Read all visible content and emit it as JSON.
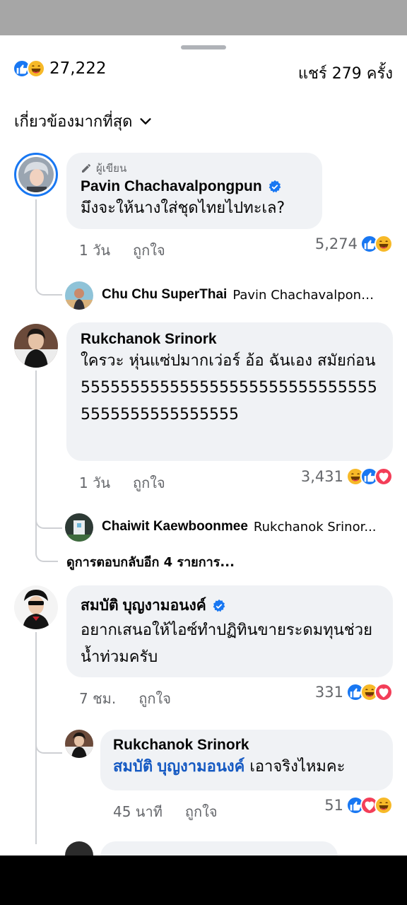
{
  "header": {
    "reaction_total": "27,222",
    "share_count": "แชร์ 279 ครั้ง",
    "reaction_icons": [
      "like-icon",
      "haha-icon"
    ]
  },
  "sort": {
    "label": "เกี่ยวข้องมากที่สุด"
  },
  "comments": [
    {
      "badge": "ผู้เขียน",
      "author": "Pavin Chachavalpongpun",
      "verified": true,
      "text": "มึงจะให้นางใส่ชุดไทยไปทะเล?",
      "time": "1 วัน",
      "like_label": "ถูกใจ",
      "reaction_count": "5,274",
      "reactions": [
        "like-icon",
        "haha-icon"
      ],
      "reply_preview": {
        "author": "Chu Chu SuperThai",
        "text": "Pavin Chachavalpong..."
      }
    },
    {
      "author": "Rukchanok Srinork",
      "verified": false,
      "text": "ใครวะ หุ่นแซ่ปมากเว่อร์ อ้อ ฉันเอง สมัยก่อน 5555555555555555555555555555555555555555555555",
      "time": "1 วัน",
      "like_label": "ถูกใจ",
      "reaction_count": "3,431",
      "reactions": [
        "haha-icon",
        "like-icon",
        "love-icon"
      ],
      "reply_preview": {
        "author": "Chaiwit Kaewboonmee",
        "text": "Rukchanok Srinor..."
      },
      "more_replies": "ดูการตอบกลับอีก 4 รายการ..."
    },
    {
      "author": "สมบัติ บุญงามอนงค์",
      "verified": true,
      "text": "อยากเสนอให้ไอซ์ทำปฏิทินขายระดมทุนช่วยน้ำท่วมครับ",
      "time": "7 ชม.",
      "like_label": "ถูกใจ",
      "reaction_count": "331",
      "reactions": [
        "like-icon",
        "haha-icon",
        "love-icon"
      ],
      "reply": {
        "author": "Rukchanok Srinork",
        "mention": "สมบัติ บุญงามอนงค์",
        "text": "เอาจริงไหมคะ",
        "time": "45 นาที",
        "like_label": "ถูกใจ",
        "reaction_count": "51",
        "reactions": [
          "like-icon",
          "love-icon",
          "haha-icon"
        ]
      }
    }
  ],
  "colors": {
    "like": "#1877f2",
    "haha": "#f7b928",
    "love": "#f33e58",
    "verified": "#1877f2",
    "mention": "#1559c2"
  }
}
